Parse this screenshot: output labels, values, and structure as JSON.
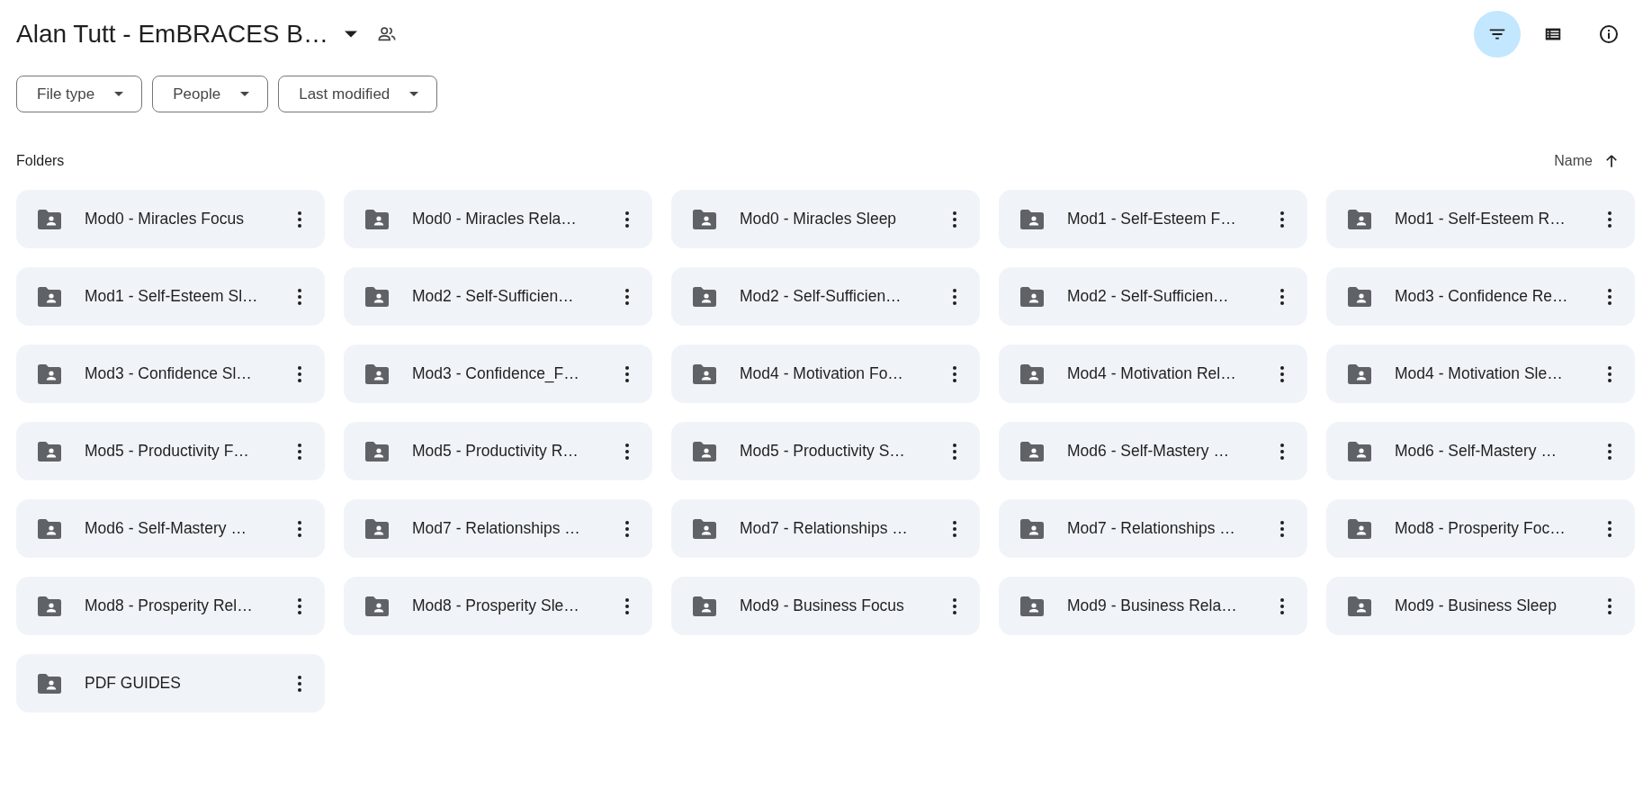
{
  "header": {
    "title": "Alan Tutt - EmBRACES B…"
  },
  "toolbar": [
    {
      "kind": "filter",
      "selected": true
    },
    {
      "kind": "list",
      "selected": false
    },
    {
      "kind": "info",
      "selected": false
    }
  ],
  "filters": [
    "File type",
    "People",
    "Last modified"
  ],
  "section": {
    "label": "Folders",
    "sort_label": "Name"
  },
  "folders": [
    "Mod0 - Miracles Focus",
    "Mod0 - Miracles Rela…",
    "Mod0 - Miracles Sleep",
    "Mod1 - Self-Esteem F…",
    "Mod1 - Self-Esteem R…",
    "Mod1 - Self-Esteem Sl…",
    "Mod2 - Self-Sufficien…",
    "Mod2 - Self-Sufficien…",
    "Mod2 - Self-Sufficien…",
    "Mod3 - Confidence Re…",
    "Mod3 - Confidence Sl…",
    "Mod3 - Confidence_F…",
    "Mod4 - Motivation Fo…",
    "Mod4 - Motivation Rel…",
    "Mod4 - Motivation Sle…",
    "Mod5 - Productivity F…",
    "Mod5 - Productivity R…",
    "Mod5 - Productivity S…",
    "Mod6 - Self-Mastery …",
    "Mod6 - Self-Mastery …",
    "Mod6 - Self-Mastery …",
    "Mod7 - Relationships …",
    "Mod7 - Relationships …",
    "Mod7 - Relationships …",
    "Mod8 - Prosperity Foc…",
    "Mod8 - Prosperity Rel…",
    "Mod8 - Prosperity Sle…",
    "Mod9 - Business Focus",
    "Mod9 - Business Rela…",
    "Mod9 - Business Sleep",
    "PDF GUIDES"
  ]
}
